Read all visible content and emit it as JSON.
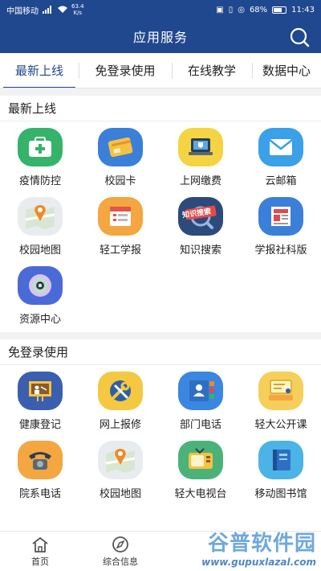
{
  "status_bar": {
    "carrier": "中国移动",
    "speed_value": "63.4",
    "speed_unit": "K/s",
    "battery": "68%",
    "time": "11:43"
  },
  "header": {
    "title": "应用服务",
    "search_icon": "search-icon"
  },
  "tabs": [
    {
      "label": "最新上线",
      "active": true
    },
    {
      "label": "免登录使用",
      "active": false
    },
    {
      "label": "在线教学",
      "active": false
    },
    {
      "label": "数据中心",
      "active": false
    }
  ],
  "sections": [
    {
      "title": "最新上线",
      "items": [
        {
          "label": "疫情防控",
          "icon": "medkit-icon"
        },
        {
          "label": "校园卡",
          "icon": "card-icon"
        },
        {
          "label": "上网缴费",
          "icon": "laptop-icon"
        },
        {
          "label": "云邮箱",
          "icon": "mail-icon"
        },
        {
          "label": "校园地图",
          "icon": "map-icon"
        },
        {
          "label": "轻工学报",
          "icon": "report-icon"
        },
        {
          "label": "知识搜索",
          "icon": "knowledge-search-icon",
          "badge": "知识搜索"
        },
        {
          "label": "学报社科版",
          "icon": "newspaper-icon"
        },
        {
          "label": "资源中心",
          "icon": "disc-icon"
        }
      ]
    },
    {
      "title": "免登录使用",
      "items": [
        {
          "label": "健康登记",
          "icon": "presentation-icon"
        },
        {
          "label": "网上报修",
          "icon": "repair-icon"
        },
        {
          "label": "部门电话",
          "icon": "contacts-icon"
        },
        {
          "label": "轻大公开课",
          "icon": "lecture-icon"
        },
        {
          "label": "院系电话",
          "icon": "telephone-icon"
        },
        {
          "label": "校园地图",
          "icon": "map-icon"
        },
        {
          "label": "轻大电视台",
          "icon": "tv-icon"
        },
        {
          "label": "移动图书馆",
          "icon": "book-icon"
        }
      ]
    }
  ],
  "bottom_nav": [
    {
      "label": "首页",
      "icon": "home-icon"
    },
    {
      "label": "综合信息",
      "icon": "compass-icon"
    }
  ],
  "watermark": {
    "name": "谷普软件园",
    "url": "www.gupuxlazal.com"
  },
  "colors": {
    "brand": "#20488f",
    "watermark": "#6fa8dc"
  }
}
